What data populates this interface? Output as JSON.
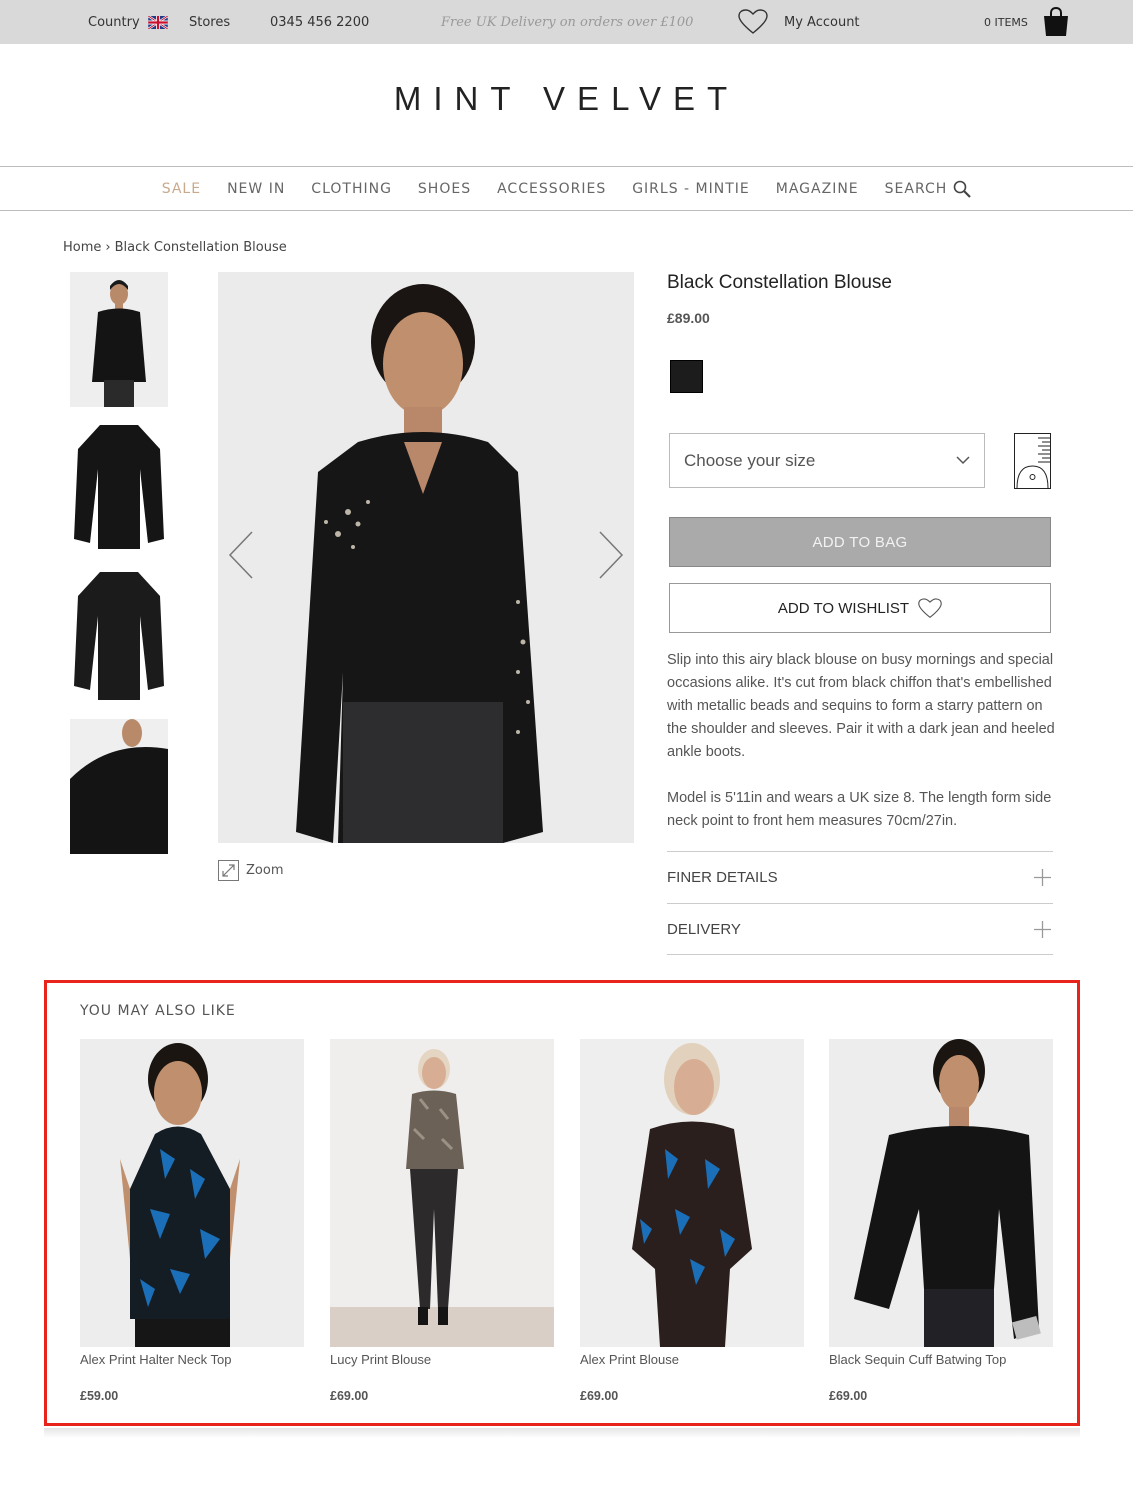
{
  "topbar": {
    "country_label": "Country",
    "stores_label": "Stores",
    "phone": "0345 456 2200",
    "delivery_message": "Free UK Delivery on orders over £100",
    "account_label": "My Account",
    "bag_count": "0 ITEMS"
  },
  "brand": {
    "logo": "MINT VELVET"
  },
  "nav": {
    "items": [
      "SALE",
      "NEW IN",
      "CLOTHING",
      "SHOES",
      "ACCESSORIES",
      "GIRLS - MINTIE",
      "MAGAZINE"
    ],
    "search_label": "SEARCH"
  },
  "breadcrumb": {
    "home": "Home",
    "separator": "›",
    "current": "Black Constellation Blouse"
  },
  "gallery": {
    "zoom_label": "Zoom"
  },
  "product": {
    "title": "Black Constellation Blouse",
    "price": "£89.00",
    "swatch_color": "#1c1c1c",
    "size_placeholder": "Choose your size",
    "add_to_bag_label": "ADD TO BAG",
    "add_to_wishlist_label": "ADD TO WISHLIST",
    "description": "Slip into this airy black blouse on busy mornings and special occasions alike. It's cut from black chiffon that's embellished with metallic beads and sequins to form a starry pattern on the shoulder and sleeves. Pair it with a dark jean and heeled ankle boots.",
    "model_info": "Model is 5'11in and wears a UK size 8. The length form side neck point to front hem measures 70cm/27in.",
    "accordions": [
      "FINER DETAILS",
      "DELIVERY"
    ]
  },
  "recommendations": {
    "title": "YOU MAY ALSO LIKE",
    "items": [
      {
        "name": "Alex Print Halter Neck Top",
        "price": "£59.00"
      },
      {
        "name": "Lucy Print Blouse",
        "price": "£69.00"
      },
      {
        "name": "Alex Print Blouse",
        "price": "£69.00"
      },
      {
        "name": "Black Sequin Cuff Batwing Top",
        "price": "£69.00"
      }
    ]
  },
  "colors": {
    "topbar_bg": "#d9d9d9",
    "sale_accent": "#c9a98c",
    "add_to_bag_bg": "#aaaaaa",
    "highlight_border": "#e8231b"
  }
}
